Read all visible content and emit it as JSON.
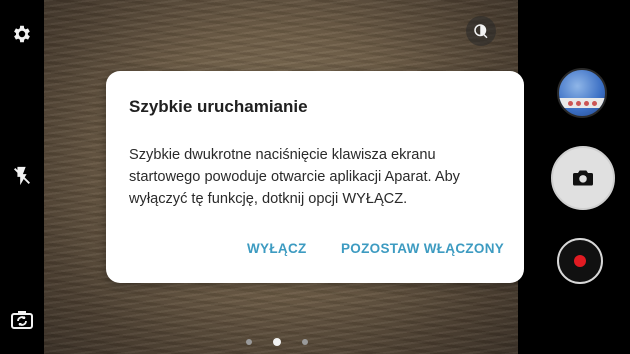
{
  "dialog": {
    "title": "Szybkie uruchamianie",
    "message": "Szybkie dwukrotne naciśnięcie klawisza ekranu startowego powoduje otwarcie aplikacji Aparat. Aby wyłączyć tę funkcję, dotknij opcji WYŁĄCZ.",
    "button_off": "WYŁĄCZ",
    "button_keep": "POZOSTAW WŁĄCZONY"
  },
  "camera": {
    "left_icons": [
      "gear-icon",
      "flash-off-icon",
      "switch-camera-icon"
    ],
    "top_icon": "filter-icon",
    "right_controls": [
      "gallery-thumbnail",
      "capture-photo-button",
      "record-video-button"
    ],
    "page_indicator": {
      "count": 3,
      "active_index": 1
    }
  },
  "colors": {
    "accent": "#3d9bc1",
    "record": "#e11b22",
    "dialog_background": "#ffffff"
  }
}
